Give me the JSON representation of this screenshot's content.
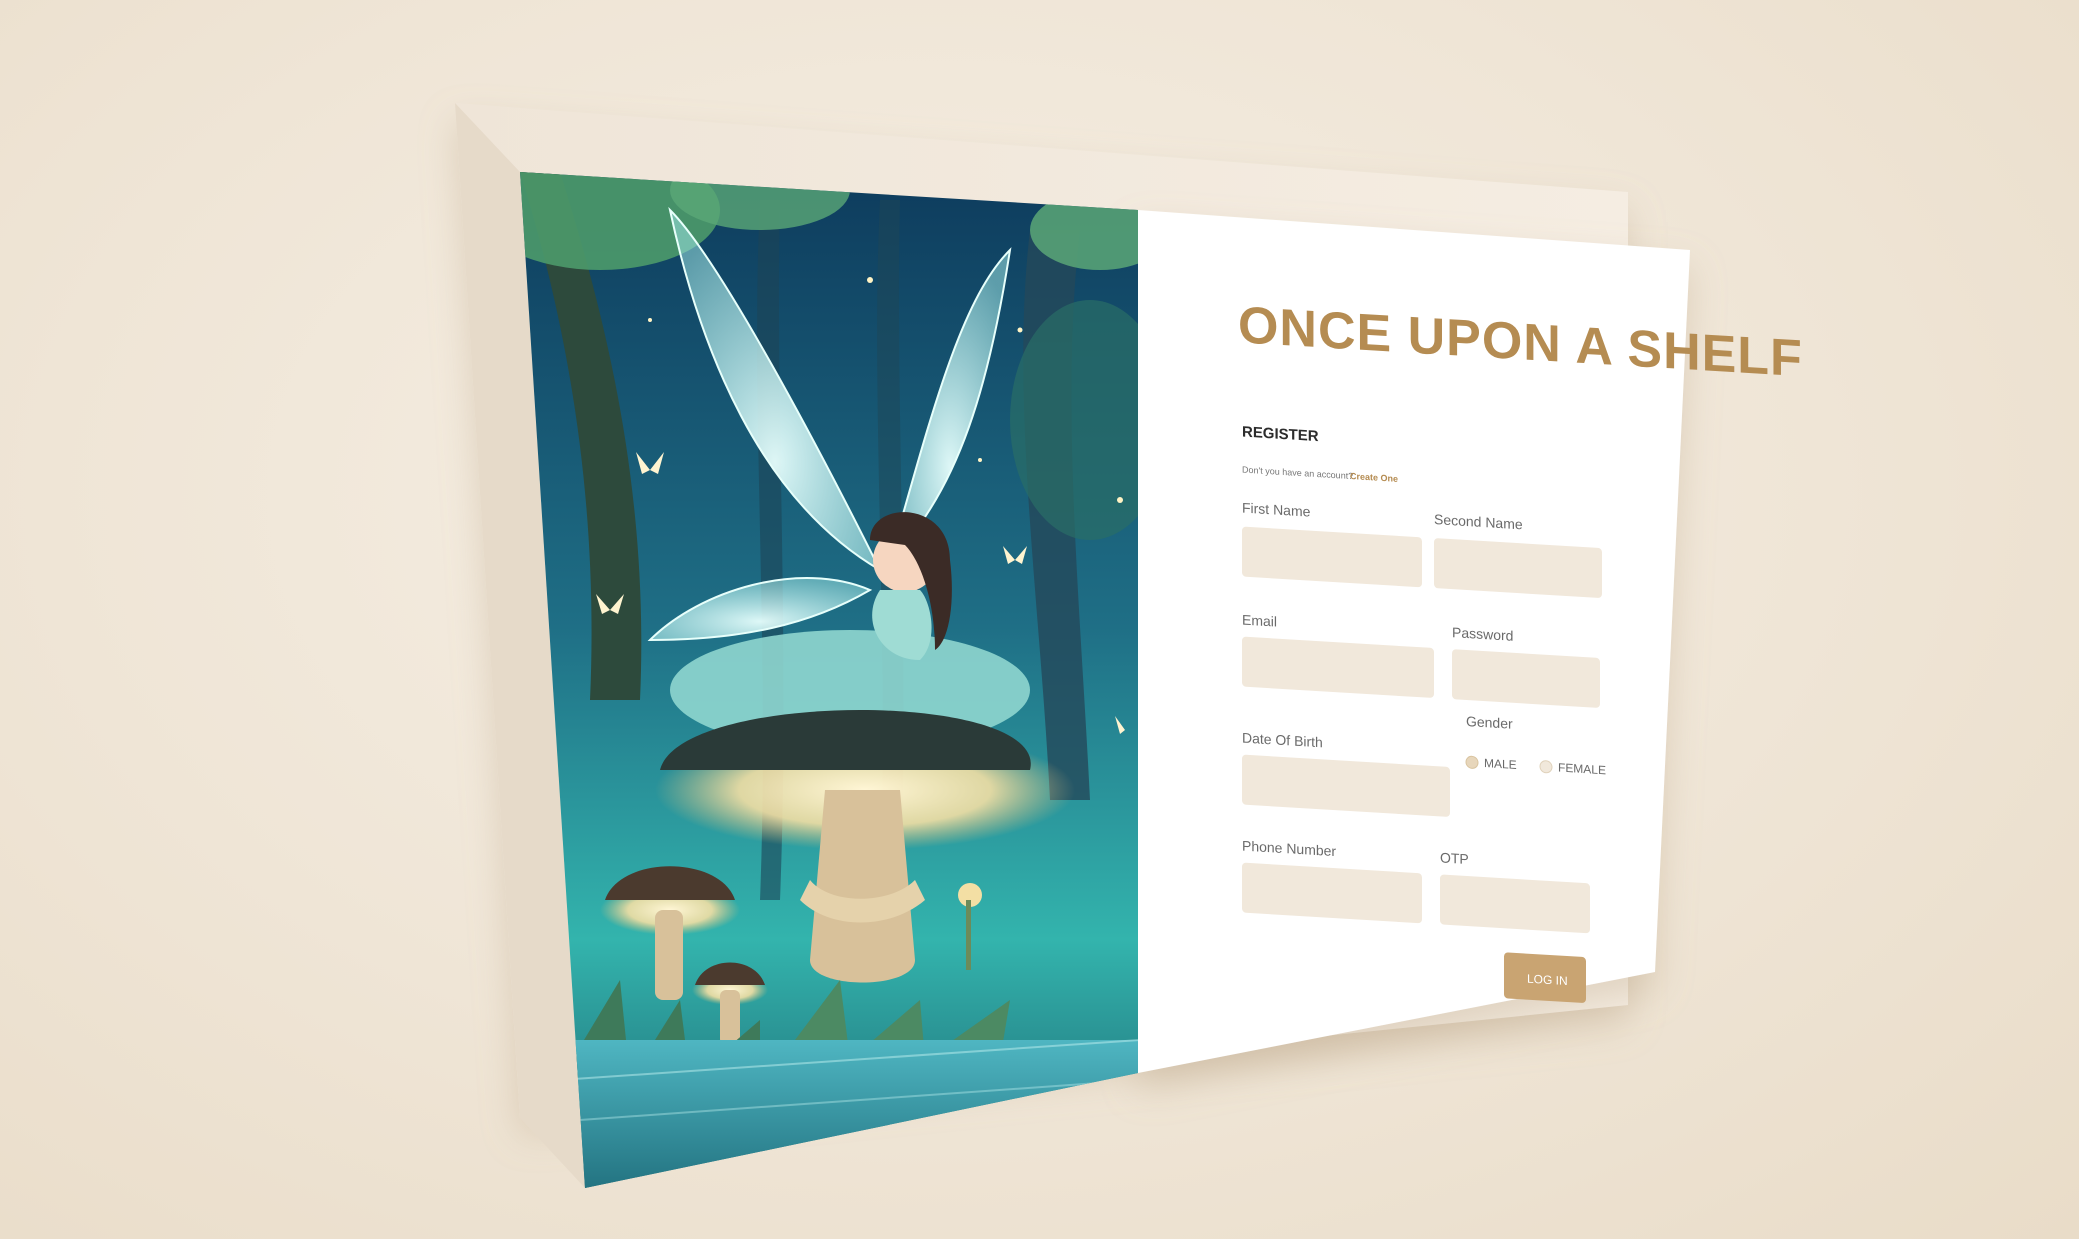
{
  "brand": {
    "title": "ONCE UPON A SHELF"
  },
  "form": {
    "heading": "REGISTER",
    "subtext": "Don't you have an account?",
    "create_link": "Create One",
    "fields": {
      "first_name_label": "First Name",
      "second_name_label": "Second Name",
      "email_label": "Email",
      "password_label": "Password",
      "dob_label": "Date Of Birth",
      "gender_label": "Gender",
      "phone_label": "Phone Number",
      "otp_label": "OTP"
    },
    "gender_options": {
      "male": "MALE",
      "female": "FEMALE"
    },
    "submit_label": "LOG IN"
  },
  "illustration": {
    "icon": "fairy-on-mushroom-illustration"
  },
  "colors": {
    "accent": "#b58c52",
    "input_bg": "#f1e8db",
    "background": "#efe5d6",
    "forest_teal": "#2fa7a3"
  }
}
